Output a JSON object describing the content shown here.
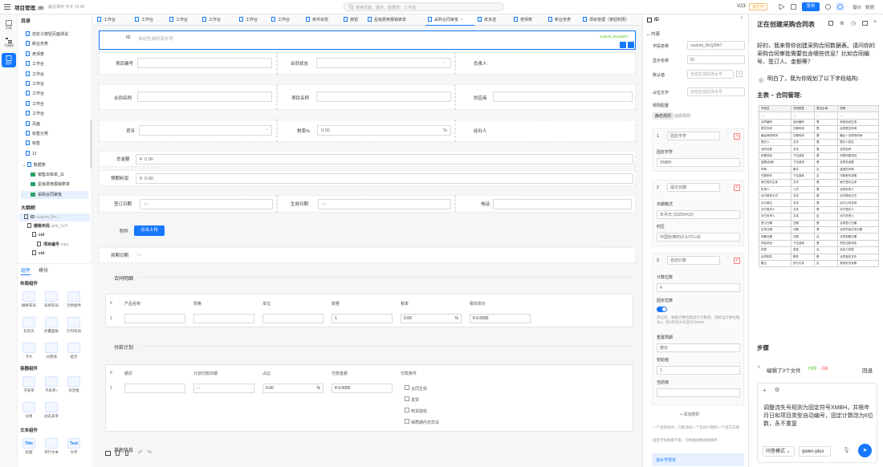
{
  "topbar": {
    "project_title": "项目管理_ttt",
    "save_status": "最近保存 今天 15:43",
    "search_placeholder": "搜索页面、模块、数据表、工作流",
    "version": "V23",
    "env": "运行中",
    "publish": "发布",
    "design": "设计",
    "data": "数据"
  },
  "rail": [
    "页面",
    "大纲树",
    "组件"
  ],
  "left_panel": {
    "directory_title": "目录",
    "tree_items": [
      "自定义按钮页面测试",
      "新业务表",
      "老师表",
      "工作台",
      "工作台",
      "工作台",
      "工作台",
      "工作台",
      "工作台",
      "页面",
      "标签分类",
      "标签",
      "12"
    ],
    "datasets_label": "数据表",
    "datasets": [
      "销售出库单_11",
      "星级费用报销表单",
      "采购合同审批"
    ],
    "outline_title": "大纲树",
    "outline_items": [
      {
        "label": "ID",
        "sub": "custom_8n..."
      },
      {
        "label": "栅格布局",
        "sub": "grid_1u7i"
      },
      {
        "label": "col",
        "sub": ""
      },
      {
        "label": "项目编号",
        "sub": "inpu"
      },
      {
        "label": "col",
        "sub": ""
      }
    ],
    "gallery_tabs": [
      "组件",
      "模块"
    ],
    "layout_group": "布局组件",
    "layout_comps": [
      "栅格布局",
      "表格布局",
      "示例组件",
      "标签页",
      "折叠面板",
      "行内布局",
      "卡片",
      "分割线",
      "提示"
    ],
    "container_group": "容器组件",
    "container_comps": [
      "子表单",
      "子表单+",
      "对话框",
      "分组",
      "动态表单"
    ],
    "text_group": "文本组件",
    "text_comps": [
      "标题",
      "单行文本",
      "文字"
    ],
    "text_icons": [
      "Title",
      "",
      "Text"
    ]
  },
  "tabs": [
    "工作台",
    "工作台",
    "工作台",
    "工作台",
    "工作台",
    "工作台",
    "条件状态",
    "按钮",
    "星级费用报销表单",
    "采购合同审批",
    "单多选",
    "老师表",
    "新业务表",
    "项目管理（按钮权限）"
  ],
  "form": {
    "id_label": "ID",
    "id_placeholder": "自动生成的流水号",
    "id_tag": "custom_8n1j30h7",
    "project_no": "项目编号",
    "contract_status": "合同状态",
    "owner": "负责人",
    "contract_name": "合同名称",
    "project_name": "项目名称",
    "supplier": "供应商",
    "currency": "货币",
    "tax_rate": "税率%",
    "tax_value": "0.00",
    "handler": "经办人",
    "total_amount": "总金额",
    "total_value": "0.00",
    "expected_profit": "预期利润",
    "profit_value": "0.00",
    "sign_date": "签订日期",
    "effective_date": "生效日期",
    "phone": "电话",
    "attachment": "附件",
    "upload": "点击上传",
    "expire_date": "到期日期",
    "section_detail": "合同明细",
    "detail_headers": [
      "#",
      "产品名称",
      "规格",
      "单位",
      "数量",
      "税率",
      "税前单价"
    ],
    "detail_row": {
      "no": "1",
      "qty": "1",
      "rate": "0.00",
      "price": "0.0000"
    },
    "section_pay": "付款计划",
    "pay_headers": [
      "#",
      "期次",
      "计划付款日期",
      "占比",
      "付款金额",
      "付款条件"
    ],
    "pay_row": {
      "no": "1",
      "ratio": "0.00",
      "amount": "0.0000"
    },
    "pay_conditions": [
      "合同生效",
      "发票",
      "到货验收",
      "保质期内无异议"
    ],
    "section_more": "其他信息",
    "currency_symbol": "¥",
    "percent": "%"
  },
  "props": {
    "title": "ID",
    "section": "内容",
    "field_name_label": "字段名称",
    "field_name_value": "custom_8n1j30h7",
    "display_label": "显示名称",
    "display_value": "ID",
    "default_label": "默认值",
    "default_value": "自动生成的流水号",
    "placeholder_label": "占位文字",
    "placeholder_value": "自动生成的流水号",
    "rules_label": "规则配置",
    "rule_tabs": [
      "静态规则",
      "动态规则"
    ],
    "rules": [
      {
        "no": "1",
        "type": "固定字符",
        "sub_label": "固定字符",
        "sub_value": "XMBH"
      },
      {
        "no": "2",
        "type": "提交日期",
        "sub_label": "日期格式",
        "sub_value": "年月日 (20250412)",
        "sub2_label": "时区",
        "sub2_value": "中国标准时间 (UTC+8)"
      },
      {
        "no": "3",
        "type": "自动计数",
        "sub_label": "计数位数",
        "sub_value": "4",
        "fixed_label": "固定位数",
        "fixed_desc": "开启后，根据计数位数显示计数值。例如当计数位数为4，则1的流水号显示为0001",
        "reset_label": "重置周期",
        "reset_value": "按日",
        "init_label": "初始值",
        "init_value": "1",
        "current_label": "当前值",
        "current_value": ""
      }
    ],
    "add_rule": "+ 添加规则",
    "tips": [
      "一个规则组中，只能添加一个自动计数和一个提交日期",
      "固定字符数量不限，可拖拽调整规则顺序"
    ],
    "preview": "流水号预览"
  },
  "chat": {
    "title": "正在创建采购合同表",
    "message": "好的，我来帮你创建采购合同数据表。请问你的采购合同审批需要包含哪些信息？比如合同编号、签订人、金额等？",
    "reply": "明白了，我为你规划了以下字段结构:",
    "main_table": "主表 – 合同管理:",
    "table_headers": [
      "字段名",
      "字段类型",
      "是否必填",
      "说明"
    ],
    "table_rows": [
      [
        "----",
        "----",
        "----",
        "----"
      ],
      [
        "合同编号",
        "自动编号",
        "是",
        "系统自动生成"
      ],
      [
        "提交时间",
        "日期时间",
        "是",
        "合同提交时间"
      ],
      [
        "最后修改时间",
        "日期时间",
        "是",
        "最后一次修改时间"
      ],
      [
        "签约人",
        "文本",
        "是",
        "签约人姓名"
      ],
      [
        "合同名称",
        "文本",
        "是",
        "合同名称"
      ],
      [
        "所属项目",
        "下拉选择",
        "是",
        "关联所属项目"
      ],
      [
        "金额(含税)",
        "下拉选择",
        "是",
        "合同总金额"
      ],
      [
        "币种",
        "数字",
        "否",
        "选用的币种"
      ],
      [
        "付款条件",
        "下拉选择",
        "否",
        "付款条件说明"
      ],
      [
        "我方签约主体",
        "文本",
        "是",
        "我方签约主体"
      ],
      [
        "负责人",
        "人员",
        "是",
        "合同负责人"
      ],
      [
        "对方联系方式",
        "文本",
        "是",
        "对方联系方式"
      ],
      [
        "对方单位",
        "文本",
        "是",
        "对方公司名称"
      ],
      [
        "对方签约人",
        "文本",
        "是",
        "对方签约人"
      ],
      [
        "对方负责人",
        "文本",
        "否",
        "对方负责人"
      ],
      [
        "签订日期",
        "日期",
        "是",
        "合同签订日期"
      ],
      [
        "生效日期",
        "日期",
        "是",
        "合同开始生效日期"
      ],
      [
        "到期日期",
        "日期",
        "否",
        "合同到期日期"
      ],
      [
        "项目状态",
        "下拉选择",
        "是",
        "项目当前状态"
      ],
      [
        "标签",
        "多选",
        "否",
        "自定义标签"
      ],
      [
        "合同附件",
        "附件",
        "是",
        "合同相关文件"
      ],
      [
        "备注",
        "多行文本",
        "否",
        "其他补充说明"
      ]
    ],
    "steps": "步骤",
    "edited": "编辑了3个文件",
    "added": "+69",
    "removed": "-36",
    "undo": "回退",
    "input_text": "调整流失号规则为固定符号XMBH，并根年月日和项目类型自动编号，固定计数改为6位数，永不重复",
    "mode": "问答模式",
    "model": "qwen-plus"
  }
}
